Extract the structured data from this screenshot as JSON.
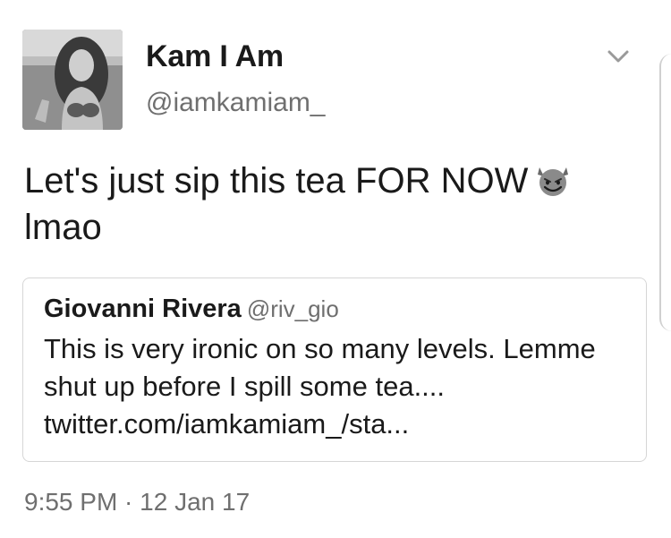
{
  "tweet": {
    "display_name": "Kam I Am",
    "handle": "@iamkamiam_",
    "text_line1": "Let's just sip this tea FOR NOW",
    "text_line2": "lmao",
    "emoji": "smiling-imp-emoji",
    "timestamp": "9:55 PM · 12 Jan 17"
  },
  "quote": {
    "display_name": "Giovanni Rivera",
    "handle": "@riv_gio",
    "text_line1": "This is very ironic on so many levels. Lemme",
    "text_line2": "shut up before I spill some tea....",
    "link": "twitter.com/iamkamiam_/sta..."
  },
  "icons": {
    "menu": "chevron-down-icon",
    "avatar": "user-avatar"
  }
}
